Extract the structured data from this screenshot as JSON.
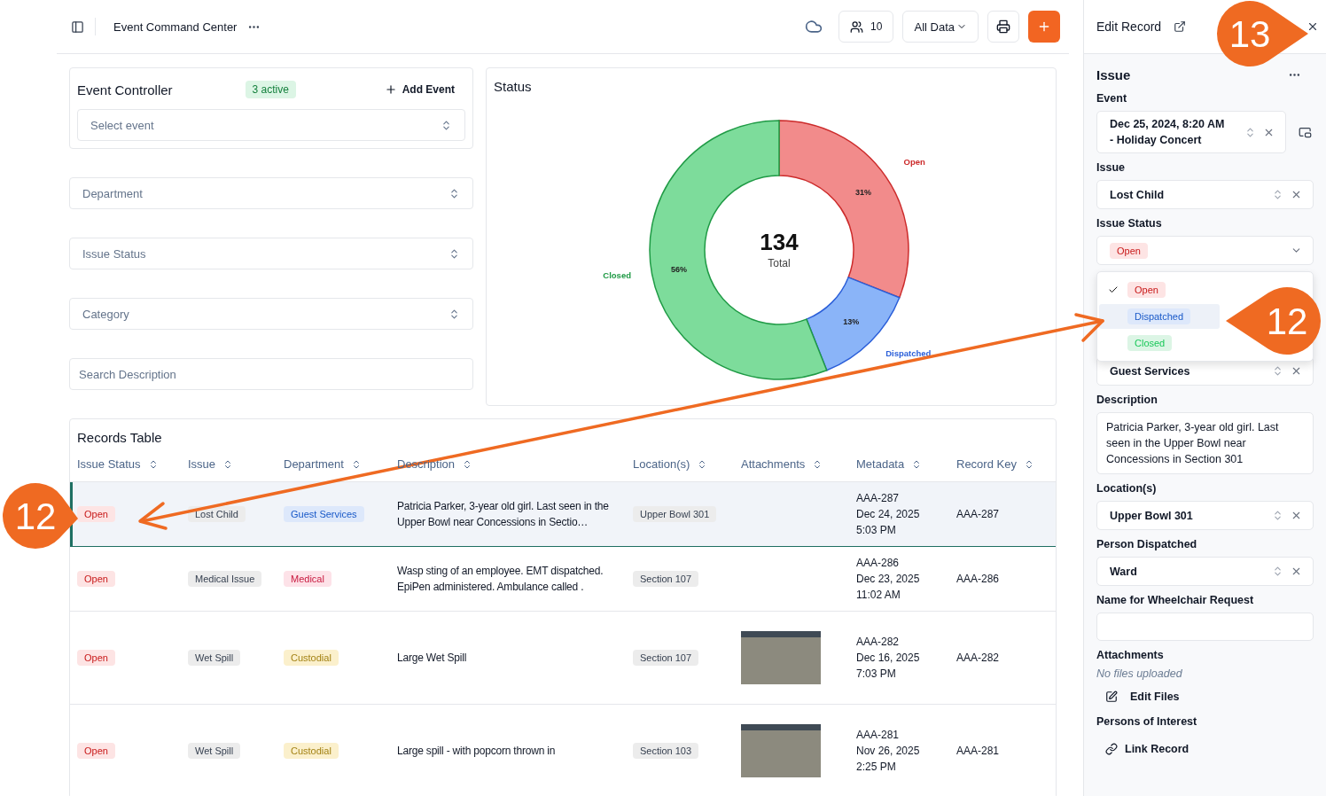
{
  "topbar": {
    "title": "Event Command Center",
    "users_count": "10",
    "data_filter": "All Data"
  },
  "event_controller": {
    "title": "Event Controller",
    "badge": "3 active",
    "add_label": "Add Event",
    "select_placeholder": "Select event"
  },
  "filters": [
    {
      "kind": "select",
      "placeholder": "Department"
    },
    {
      "kind": "select",
      "placeholder": "Issue Status"
    },
    {
      "kind": "select",
      "placeholder": "Category"
    },
    {
      "kind": "search",
      "placeholder": "Search Description"
    }
  ],
  "status": {
    "title": "Status",
    "total": "134",
    "total_label": "Total",
    "chart_data": {
      "type": "donut",
      "categories": [
        "Open",
        "Dispatched",
        "Closed"
      ],
      "values": [
        31,
        13,
        56
      ],
      "data_labels": true,
      "colors": [
        "#cc2b2b",
        "#2b5fd9",
        "#1f9a45"
      ],
      "value_labels": [
        "31%",
        "13%",
        "56%"
      ]
    }
  },
  "table": {
    "title": "Records Table",
    "columns": [
      "Issue Status",
      "Issue",
      "Department",
      "Description",
      "Location(s)",
      "Attachments",
      "Metadata",
      "Record Key"
    ],
    "rows": [
      {
        "selected": true,
        "status": {
          "label": "Open",
          "color": "#fde4e4"
        },
        "issue": "Lost Child",
        "department": {
          "label": "Guest Services",
          "color": "#dde8fb"
        },
        "description": "Patricia Parker, 3-year old girl. Last seen in the Upper Bowl near Concessions in Sectio…",
        "location": "Upper Bowl 301",
        "photo": false,
        "metadata": [
          "AAA-287",
          "Dec 24, 2025",
          "5:03 PM"
        ],
        "record_key": "AAA-287"
      },
      {
        "selected": false,
        "status": {
          "label": "Open",
          "color": "#fde4e4"
        },
        "issue": "Medical Issue",
        "department": {
          "label": "Medical",
          "color": "#fde2e8"
        },
        "description": "Wasp sting of an employee. EMT dispatched. EpiPen administered. Ambulance called .",
        "location": "Section 107",
        "photo": false,
        "metadata": [
          "AAA-286",
          "Dec 23, 2025",
          "11:02 AM"
        ],
        "record_key": "AAA-286"
      },
      {
        "selected": false,
        "status": {
          "label": "Open",
          "color": "#fde4e4"
        },
        "issue": "Wet Spill",
        "department": {
          "label": "Custodial",
          "color": "#fbf0cc"
        },
        "description": "Large Wet Spill",
        "location": "Section 107",
        "photo": true,
        "metadata": [
          "AAA-282",
          "Dec 16, 2025",
          "7:03 PM"
        ],
        "record_key": "AAA-282"
      },
      {
        "selected": false,
        "status": {
          "label": "Open",
          "color": "#fde4e4"
        },
        "issue": "Wet Spill",
        "department": {
          "label": "Custodial",
          "color": "#fbf0cc"
        },
        "description": "Large spill - with popcorn thrown in",
        "location": "Section 103",
        "photo": true,
        "metadata": [
          "AAA-281",
          "Nov 26, 2025",
          "2:25 PM"
        ],
        "record_key": "AAA-281"
      }
    ]
  },
  "edit_panel": {
    "title": "Edit Record",
    "section": "Issue",
    "fields": [
      {
        "kind": "select",
        "label": "Event",
        "value": "Dec 25, 2024, 8:20 AM\n- Holiday Concert",
        "side_button": true
      },
      {
        "kind": "select",
        "label": "Issue",
        "value": "Lost Child",
        "side_button": false
      },
      {
        "kind": "status",
        "label": "Issue Status",
        "value": {
          "label": "Open",
          "color": "#fde4e4"
        },
        "menu": [
          {
            "label": "Open",
            "color": "#fde4e4",
            "selected": true,
            "highlighted": false
          },
          {
            "label": "Dispatched",
            "color": "#dde8fb",
            "selected": false,
            "highlighted": true
          },
          {
            "label": "Closed",
            "color": "#dcf5e5",
            "selected": false,
            "highlighted": false
          }
        ]
      },
      {
        "kind": "select",
        "value": "Guest Services",
        "side_button": false
      },
      {
        "kind": "textarea",
        "label": "Description",
        "value": "Patricia Parker, 3-year old girl. Last seen in the Upper Bowl near Concessions in Section 301"
      },
      {
        "kind": "select",
        "label": "Location(s)",
        "value": "Upper Bowl 301",
        "side_button": false
      },
      {
        "kind": "select",
        "label": "Person Dispatched",
        "value": "Ward",
        "side_button": false
      },
      {
        "kind": "input",
        "label": "Name for Wheelchair Request"
      },
      {
        "kind": "files",
        "label": "Attachments",
        "note": "No files uploaded",
        "action": "Edit Files"
      },
      {
        "kind": "links",
        "label": "Persons of Interest",
        "action": "Link Record"
      }
    ]
  },
  "annotations": [
    {
      "kind": "callout",
      "number": "13"
    },
    {
      "kind": "callout",
      "number": "12"
    },
    {
      "kind": "callout",
      "number": "12"
    },
    {
      "kind": "arrow"
    }
  ]
}
